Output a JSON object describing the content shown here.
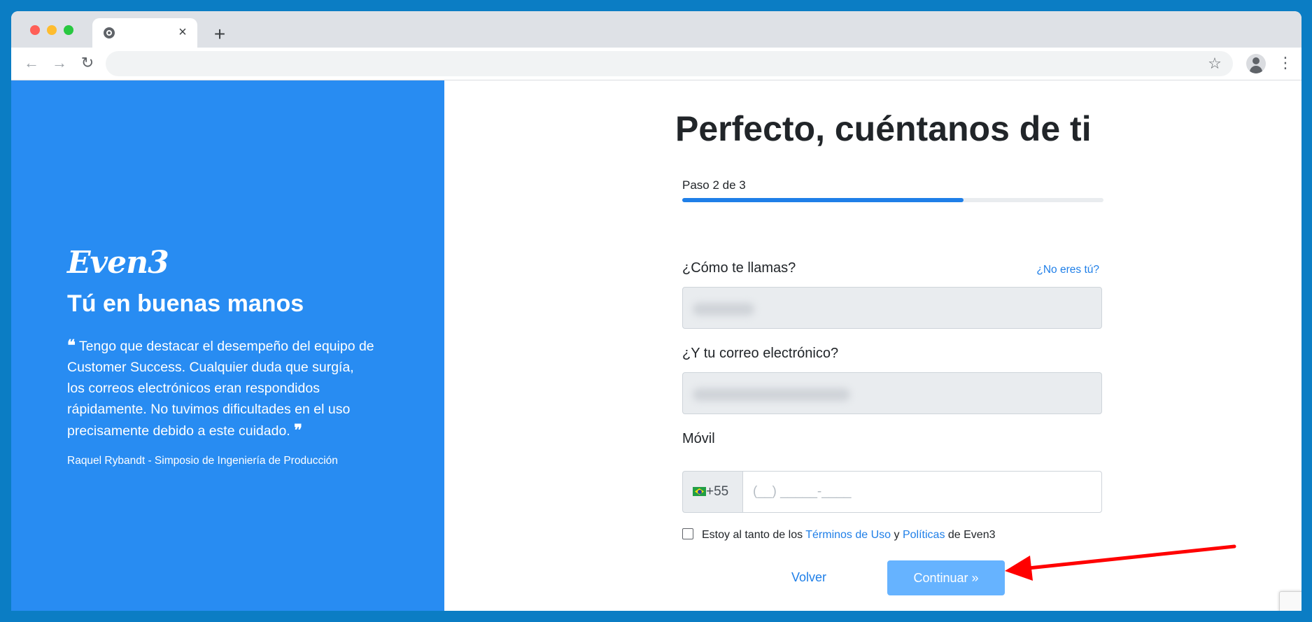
{
  "browser": {
    "tab_close_glyph": "×",
    "new_tab_glyph": "+",
    "back_glyph": "←",
    "forward_glyph": "→",
    "reload_glyph": "↻",
    "star_glyph": "☆",
    "menu_glyph": "⋮",
    "address": ""
  },
  "left_panel": {
    "background": "#288cf2",
    "logo_text": "Even3",
    "tagline": "Tú en buenas manos",
    "quote_open": "❝",
    "quote_text": "Tengo que destacar el desempeño del equipo de Customer Success. Cualquier duda que surgía, los correos electrónicos eran respondidos rápidamente. No tuvimos dificultades en el uso precisamente debido a este cuidado.",
    "quote_close": "❞",
    "quote_author": "Raquel Rybandt - Simposio de Ingeniería de Producción"
  },
  "form": {
    "title": "Perfecto, cuéntanos de ti",
    "step_label": "Paso 2 de 3",
    "progress_fraction": 0.667,
    "name_label": "¿Cómo te llamas?",
    "not_you_link": "¿No eres tú?",
    "email_label": "¿Y tu correo electrónico?",
    "phone_label": "Móvil",
    "phone_prefix": "+55",
    "phone_placeholder": "(__) _____-____",
    "terms": {
      "prefix": "Estoy al tanto de los ",
      "terms_link": "Términos de Uso",
      "and": " y ",
      "policies_link": "Políticas",
      "suffix": " de Even3"
    },
    "back_label": "Volver",
    "continue_label": "Continuar »"
  },
  "colors": {
    "accent": "#1f7fe8",
    "button": "#66b3ff",
    "annotation_arrow": "#ff0000"
  }
}
